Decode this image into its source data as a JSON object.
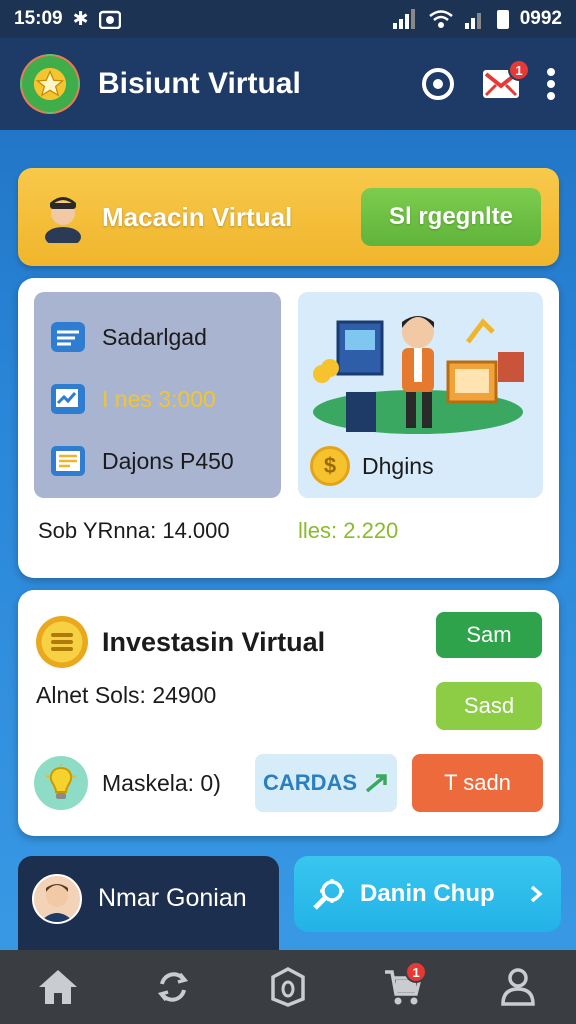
{
  "status_bar": {
    "time": "15:09",
    "battery": "0992"
  },
  "app_bar": {
    "title": "Bisiunt Virtual",
    "notification_count": "1"
  },
  "banner": {
    "greeting": "Macacin Virtual",
    "button_label": "Sl rgegnlte"
  },
  "summary": {
    "stats": [
      {
        "icon": "document-stack-icon",
        "label": "Sadarlgad"
      },
      {
        "icon": "chart-doc-icon",
        "label": "I nes 3:000"
      },
      {
        "icon": "form-icon",
        "label": "Dajons P450"
      }
    ],
    "illustration_label": "Dhgins",
    "coin_symbol": "$",
    "total_left": "Sob YRnna: 14.000",
    "total_right": "lles: 2.220"
  },
  "investment": {
    "title": "Investasin Virtual",
    "balance": "Alnet Sols: 24900",
    "btn_primary": "Sam",
    "btn_secondary": "Sasd",
    "market_label": "Maskela: 0)",
    "cards_label": "CARDAS",
    "orange_label": "T sadn"
  },
  "profile": {
    "name": "Nmar Gonian"
  },
  "chat": {
    "label": "Danin Chup"
  },
  "nav": {
    "cart_badge": "1"
  },
  "colors": {
    "primary_dark": "#1e3a66",
    "accent_yellow": "#f0b52c",
    "accent_green": "#2fa34b",
    "accent_orange": "#ec6a3c",
    "accent_cyan": "#22b2e6"
  }
}
